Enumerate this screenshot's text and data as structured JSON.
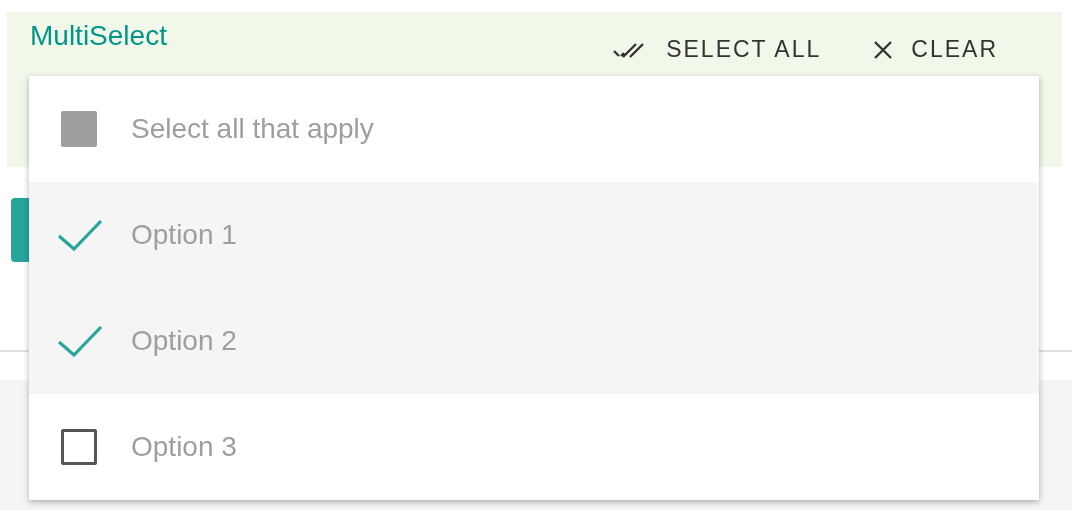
{
  "header": {
    "title": "MultiSelect",
    "actions": [
      {
        "kind": "select-all",
        "label": "SELECT ALL"
      },
      {
        "kind": "clear",
        "label": "CLEAR"
      }
    ]
  },
  "menu": {
    "items": [
      {
        "label": "Select all that apply",
        "disabled": true
      },
      {
        "label": "Option 1",
        "checked": true
      },
      {
        "label": "Option 2",
        "checked": true
      },
      {
        "label": "Option 3",
        "checked": false
      }
    ]
  }
}
